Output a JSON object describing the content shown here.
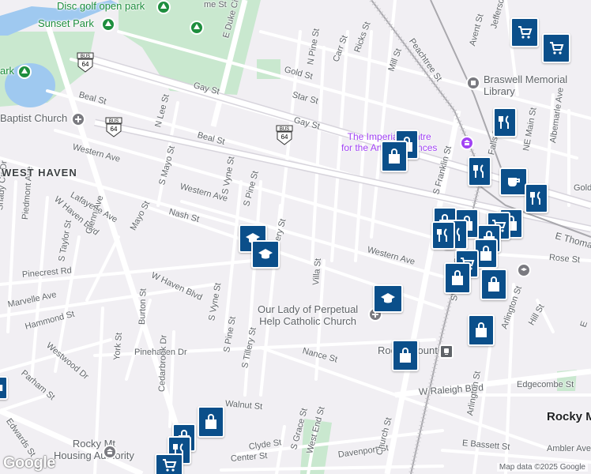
{
  "map": {
    "streets": [
      "Disc golf open park",
      "Sunset Park",
      "E Duke Cir",
      "N Pine St",
      "Carr St",
      "Ricks St",
      "Peachtree St",
      "Avent St",
      "Jefferson",
      "Gold St",
      "Mill St",
      "BUS",
      "64",
      "Gay St",
      "Star St",
      "Beal St",
      "N Lee St",
      "Gay St",
      "Beal St",
      "Western Ave",
      "Western Ave",
      "S Mayo St",
      "S Vyne St",
      "S Pine St",
      "Lafayette Ave",
      "W Haven Blvd",
      "Glenn Ave",
      "Mayo St",
      "Nash St",
      "S Tillery St",
      "Shady Cir Dr",
      "Piedmont Ave",
      "S Taylor St",
      "Pinecrest Rd",
      "W Haven Blvd",
      "Villa St",
      "Western Ave",
      "Rose St",
      "S Vyne St",
      "Marvelle Ave",
      "Burton St",
      "Hammond St",
      "Westwood Dr",
      "York St",
      "Pinehaven Dr",
      "S Pine St",
      "S Tillery St",
      "Nance St",
      "Parham St",
      "Cedarbrook Dr",
      "Edwards St",
      "Walnut St",
      "W Raleigh Blvd",
      "Edgecombe St",
      "Clyde St",
      "Center St",
      "S Grace St",
      "West End St",
      "Davenport St",
      "Church St",
      "E Bassett St",
      "Ambler Ave",
      "Arlington St",
      "Hill St",
      "Arlington St",
      "SW Main St",
      "S Franklin St",
      "Falls Rd",
      "NE Main St",
      "Albemarle Ave",
      "E Thomas",
      "Gold",
      "E"
    ],
    "areas": {
      "west_haven": "WEST HAVEN",
      "rocky_mount": "Rocky M",
      "baptist": "Baptist Church",
      "park_left": "ark"
    },
    "pois": {
      "library": "Braswell Memorial Library",
      "centre_line1": "The Imperial Centre",
      "centre_line2": "for the Arts & Sciences",
      "church_line1": "Our Lady of Perpetual",
      "church_line2": "Help Catholic Church",
      "station": "Rocky Mount",
      "housing_line1": "Rocky Mt",
      "housing_line2": "Housing Authority"
    },
    "attribution": "Map data ©2025 Google",
    "logo": "Google"
  }
}
